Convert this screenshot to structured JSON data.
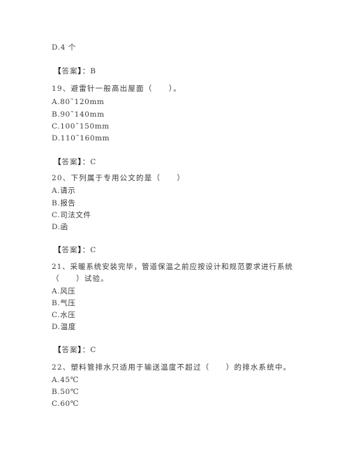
{
  "document": {
    "blocks": [
      {
        "type": "option_tail",
        "options": [
          {
            "letter": "D.",
            "text": "4 个"
          }
        ],
        "answer": {
          "open": "【",
          "label": "答案",
          "close": "】",
          "sep": "：",
          "value": "B"
        }
      },
      {
        "number": "19",
        "question": "19、避雷针一般高出屋面（　　）。",
        "question_cont": "",
        "options": [
          {
            "letter": "A.",
            "text": "80˜120mm"
          },
          {
            "letter": "B.",
            "text": "90˜140mm"
          },
          {
            "letter": "C.",
            "text": "100˜150mm"
          },
          {
            "letter": "D.",
            "text": "110˜160mm"
          }
        ],
        "answer": {
          "open": "【",
          "label": "答案",
          "close": "】",
          "sep": "：",
          "value": "C"
        }
      },
      {
        "number": "20",
        "question": "20、下列属于专用公文的是（　　）",
        "question_cont": "",
        "options": [
          {
            "letter": "A.",
            "text": "请示"
          },
          {
            "letter": "B.",
            "text": "报告"
          },
          {
            "letter": "C.",
            "text": "司法文件"
          },
          {
            "letter": "D.",
            "text": "函"
          }
        ],
        "answer": {
          "open": "【",
          "label": "答案",
          "close": "】",
          "sep": "：",
          "value": "C"
        }
      },
      {
        "number": "21",
        "question": "21、采暖系统安装完毕，管道保温之前应按设计和规范要求进行系统",
        "question_cont": "（　　）试验。",
        "options": [
          {
            "letter": "A.",
            "text": "风压"
          },
          {
            "letter": "B.",
            "text": "气压"
          },
          {
            "letter": "C.",
            "text": "水压"
          },
          {
            "letter": "D.",
            "text": "温度"
          }
        ],
        "answer": {
          "open": "【",
          "label": "答案",
          "close": "】",
          "sep": "：",
          "value": "C"
        }
      },
      {
        "number": "22",
        "question": "22、塑料管排水只适用于输送温度不超过（　　）的排水系统中。",
        "question_cont": "",
        "options": [
          {
            "letter": "A.",
            "text": "45℃"
          },
          {
            "letter": "B.",
            "text": "50℃"
          },
          {
            "letter": "C.",
            "text": "60℃"
          }
        ]
      }
    ]
  }
}
